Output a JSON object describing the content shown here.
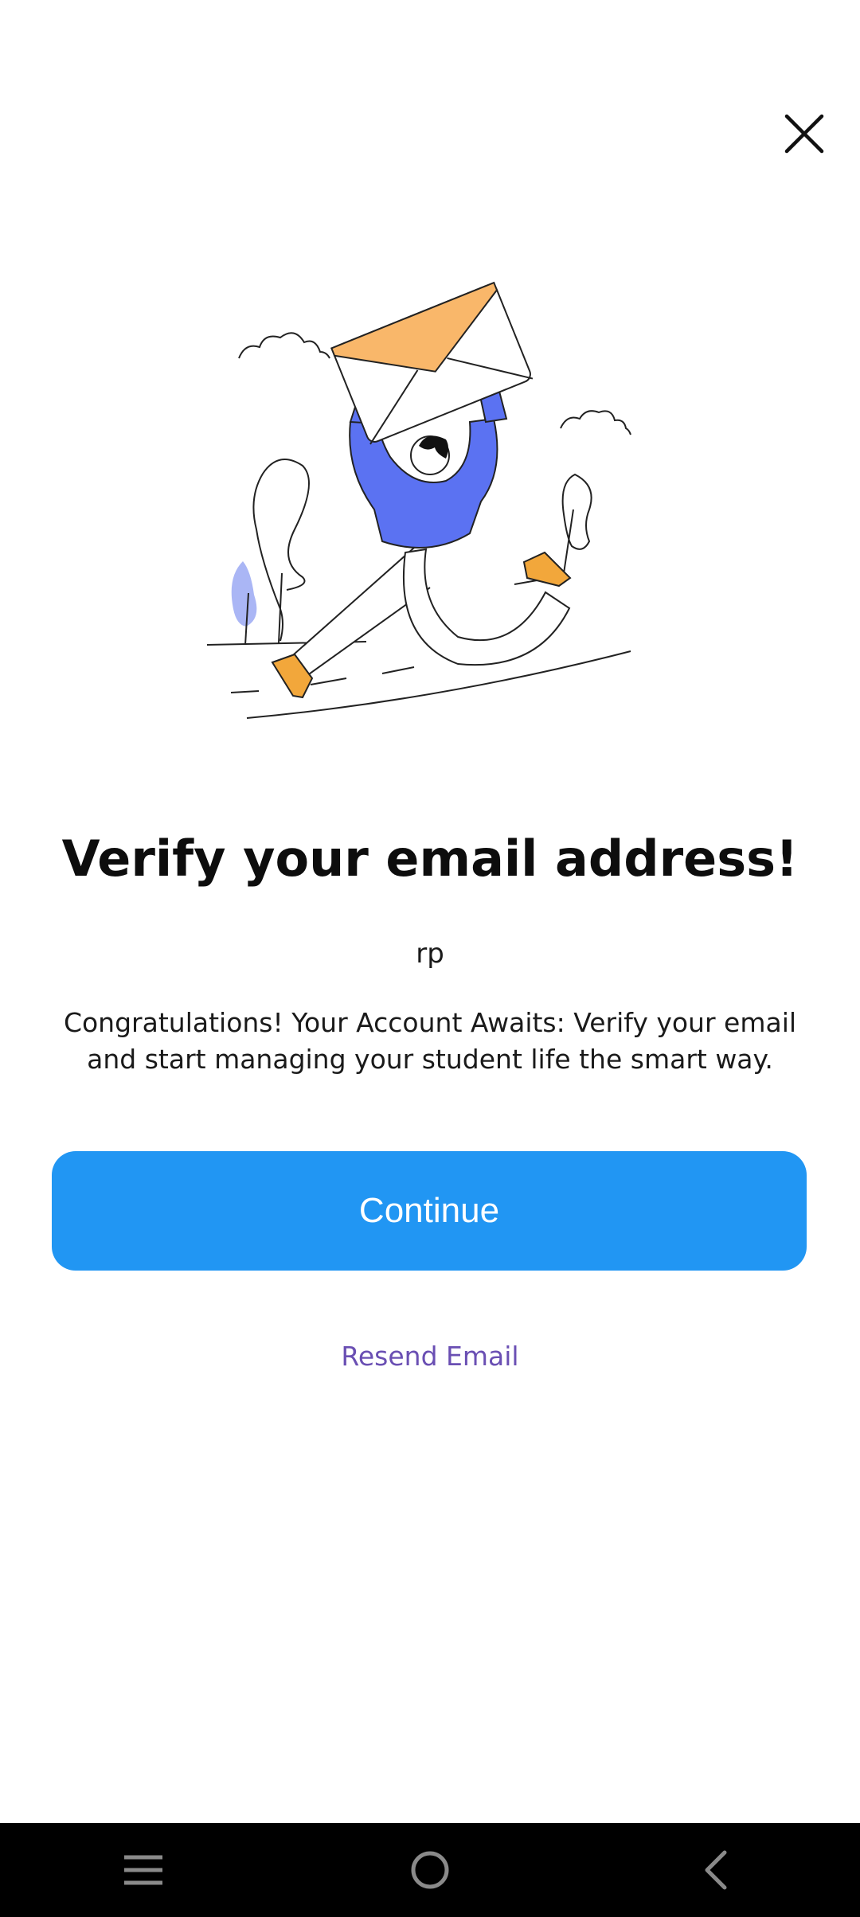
{
  "dialog": {
    "close_icon": "close-icon",
    "title": "Verify your email address!",
    "user_name": "rp",
    "description": "Congratulations! Your Account Awaits: Verify your email and start managing your student life the smart way.",
    "continue_label": "Continue",
    "resend_label": "Resend Email"
  },
  "colors": {
    "primary_button": "#2196f3",
    "link": "#6a4fb3",
    "envelope": "#f9b76a",
    "shirt": "#5b72f2",
    "shoes": "#f2a73b",
    "nav_bar": "#000000"
  },
  "nav": {
    "items": [
      {
        "icon": "recent-apps-icon"
      },
      {
        "icon": "home-icon"
      },
      {
        "icon": "back-icon"
      }
    ]
  }
}
